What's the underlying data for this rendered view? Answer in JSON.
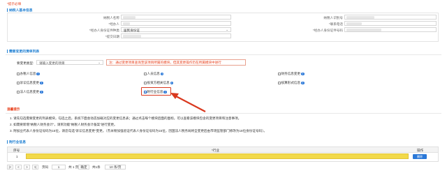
{
  "tip_text": "*提示必填",
  "colors": {
    "accent": "#1f7fd2",
    "warning": "#e8401c",
    "table_row": "#f2d94a",
    "callout": "#d9381e"
  },
  "basic_info": {
    "title": "纳税人基本信息",
    "fields": [
      {
        "label": "纳税人名称",
        "value": ""
      },
      {
        "label": "纳税人识别号",
        "value": ""
      },
      {
        "label": "*经办人",
        "value": ""
      },
      {
        "label": "*联系电话",
        "value": ""
      },
      {
        "label": "*经办人身份证件种类",
        "value": "居民身份证"
      },
      {
        "label": "*经办人身份证件号码",
        "value": ""
      },
      {
        "label": "*提交日期",
        "value": ""
      }
    ]
  },
  "change_section": {
    "title": "需要变更的清单列表",
    "filter_label": "要变更类型:",
    "filter_placeholder": "请输入变更的项目",
    "notice": "注：通过变更项目查询至该项目所属的模块，但其变更操作仍在所属模块中进行",
    "options": [
      {
        "label": "办税人信息",
        "checked": false
      },
      {
        "label": "人员信息",
        "checked": false
      },
      {
        "label": "财务信息变更",
        "checked": false
      },
      {
        "label": "诉讼信息变更",
        "checked": false
      },
      {
        "label": "投资方相关信息",
        "checked": false
      },
      {
        "label": "核算形式信息",
        "checked": false
      },
      {
        "label": "法人信息变更",
        "checked": false
      },
      {
        "label": "附行业信息",
        "checked": true
      }
    ]
  },
  "tips_section": {
    "title": "温馨提示",
    "items": [
      "1. 请先勾选需要变更的列表模块，勾选之后，系统下面会动态加载对应的变更信息表；通过点击每个模块后面的图标，可以查看该模块包含的变更项目和注意事项。",
      "2. 如需要新增“纳税人财务会计”，请到功能“纳税人财务会计备案”进行变更。",
      "3. 附加业代表人身份证号码为15位，请您勾选“诉讼信息变更”变更。（杰米顿加强验证代表人身份证号码为15位，因国法人税务局将全变更后由市场监管部门修改为18位身份证号码）。"
    ]
  },
  "industry_section": {
    "title": "附行业信息",
    "columns": [
      "序号",
      "*行业",
      "操作"
    ],
    "rows": [
      {
        "index": "1",
        "industry": "",
        "action": "删除"
      }
    ]
  },
  "pagination": {
    "first": "|<",
    "prev": "<",
    "next": ">",
    "last": ">|",
    "page_label": "页码",
    "current_page": "1",
    "total_label": "共 1 页",
    "confirm": "确定",
    "total_records": "共1条",
    "page_size": "10 条/页"
  }
}
